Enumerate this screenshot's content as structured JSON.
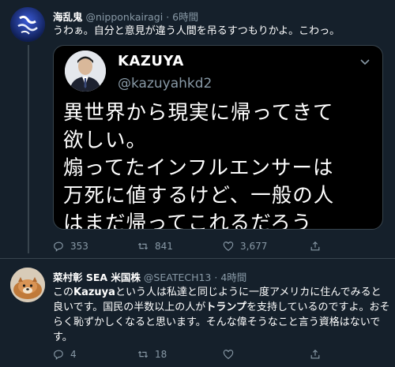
{
  "tweets": [
    {
      "display_name": "海乱鬼",
      "handle": "@nipponkairagi",
      "time": "· 6時間",
      "text": "うわぁ。自分と意見が違う人間を吊るすつもりかよ。こわっ。",
      "quote": {
        "display_name": "KAZUYA",
        "handle": "@kazuyahkd2",
        "text": "異世界から現実に帰ってきて\n欲しい。\n煽ってたインフルエンサーは\n万死に値するけど、一般の人\nはまだ帰ってこれるだろう"
      },
      "actions": {
        "replies": "353",
        "retweets": "841",
        "likes": "3,677"
      }
    },
    {
      "display_name": "菜村彰 SEA 米国株",
      "handle": "@SEATECH13",
      "time": "· 4時間",
      "text_parts": [
        {
          "t": "この",
          "b": false
        },
        {
          "t": "Kazuya",
          "b": true
        },
        {
          "t": "という人は私達と同じように一度アメリカに住んでみると良いです。国民の半数以上の人が",
          "b": false
        },
        {
          "t": "トランプ",
          "b": true
        },
        {
          "t": "を支持しているのですよ。おそらく恥ずかしくなると思います。そんな偉そうなこと言う資格はないです。",
          "b": false
        }
      ],
      "actions": {
        "replies": "4",
        "retweets": "18",
        "likes": ""
      }
    }
  ],
  "icons": [
    "reply-icon",
    "retweet-icon",
    "like-icon",
    "share-icon",
    "chevron-down-icon"
  ],
  "colors": {
    "background": "#15202b",
    "secondary_text": "#8899a6",
    "border": "#38444d"
  }
}
